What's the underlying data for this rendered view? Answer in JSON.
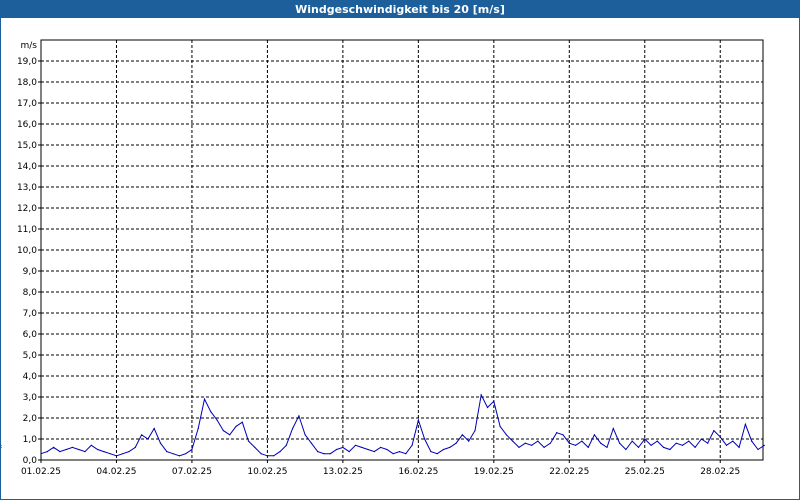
{
  "window": {
    "title": "Windgeschwindigkeit bis 20 [m/s]"
  },
  "colors": {
    "titlebar": "#1d5f9a",
    "series": "#0000b4",
    "grid": "#000000",
    "background": "#ffffff"
  },
  "chart_data": {
    "type": "line",
    "title": "Windgeschwindigkeit bis 20 [m/s]",
    "ylabel": "m/s",
    "xlabel": "",
    "ylim": [
      0,
      20
    ],
    "xlim": [
      "01.02.25",
      "01.03.25"
    ],
    "grid": true,
    "y_ticks": [
      "0,0",
      "1,0",
      "2,0",
      "3,0",
      "4,0",
      "5,0",
      "6,0",
      "7,0",
      "8,0",
      "9,0",
      "10,0",
      "11,0",
      "12,0",
      "13,0",
      "14,0",
      "15,0",
      "16,0",
      "17,0",
      "18,0",
      "19,0"
    ],
    "x_ticks": [
      "01.02.25",
      "04.02.25",
      "07.02.25",
      "10.02.25",
      "13.02.25",
      "16.02.25",
      "19.02.25",
      "22.02.25",
      "25.02.25",
      "28.02.25"
    ],
    "series": [
      {
        "x_days": [
          0,
          0.25,
          0.5,
          0.75,
          1,
          1.25,
          1.5,
          1.75,
          2,
          2.25,
          2.5,
          2.75,
          3,
          3.25,
          3.5,
          3.75,
          4,
          4.25,
          4.5,
          4.75,
          5,
          5.25,
          5.5,
          5.75,
          6,
          6.25,
          6.5,
          6.75,
          7,
          7.25,
          7.5,
          7.75,
          8,
          8.25,
          8.5,
          8.75,
          9,
          9.25,
          9.5,
          9.75,
          10,
          10.25,
          10.5,
          10.75,
          11,
          11.25,
          11.5,
          11.75,
          12,
          12.25,
          12.5,
          12.75,
          13,
          13.25,
          13.5,
          13.75,
          14,
          14.25,
          14.5,
          14.75,
          15,
          15.25,
          15.5,
          15.75,
          16,
          16.25,
          16.5,
          16.75,
          17,
          17.25,
          17.5,
          17.75,
          18,
          18.25,
          18.5,
          18.75,
          19,
          19.25,
          19.5,
          19.75,
          20,
          20.25,
          20.5,
          20.75,
          21,
          21.25,
          21.5,
          21.75,
          22,
          22.25,
          22.5,
          22.75,
          23,
          23.25,
          23.5,
          23.75,
          24,
          24.25,
          24.5,
          24.75,
          25,
          25.25,
          25.5,
          25.75,
          26,
          26.25,
          26.5,
          26.75,
          27,
          27.25,
          27.5,
          27.75,
          28,
          28.25,
          28.5,
          28.75
        ],
        "values": [
          0.3,
          0.4,
          0.6,
          0.4,
          0.5,
          0.6,
          0.5,
          0.4,
          0.7,
          0.5,
          0.4,
          0.3,
          0.2,
          0.3,
          0.4,
          0.6,
          1.2,
          1.0,
          1.5,
          0.8,
          0.4,
          0.3,
          0.2,
          0.3,
          0.5,
          1.5,
          2.9,
          2.3,
          1.9,
          1.4,
          1.2,
          1.6,
          1.8,
          0.9,
          0.6,
          0.3,
          0.2,
          0.2,
          0.4,
          0.7,
          1.5,
          2.1,
          1.2,
          0.8,
          0.4,
          0.3,
          0.3,
          0.5,
          0.6,
          0.4,
          0.7,
          0.6,
          0.5,
          0.4,
          0.6,
          0.5,
          0.3,
          0.4,
          0.3,
          0.7,
          1.9,
          1.0,
          0.4,
          0.3,
          0.5,
          0.6,
          0.8,
          1.2,
          0.9,
          1.4,
          3.1,
          2.5,
          2.8,
          1.6,
          1.2,
          0.9,
          0.6,
          0.8,
          0.7,
          0.9,
          0.6,
          0.8,
          1.3,
          1.2,
          0.8,
          0.7,
          0.9,
          0.6,
          1.2,
          0.8,
          0.6,
          1.5,
          0.8,
          0.5,
          0.9,
          0.6,
          1.0,
          0.7,
          0.9,
          0.6,
          0.5,
          0.8,
          0.7,
          0.9,
          0.6,
          1.0,
          0.8,
          1.4,
          1.1,
          0.7,
          0.9,
          0.6,
          1.7,
          0.9,
          0.5,
          0.7,
          0.6,
          0.7
        ]
      }
    ]
  }
}
